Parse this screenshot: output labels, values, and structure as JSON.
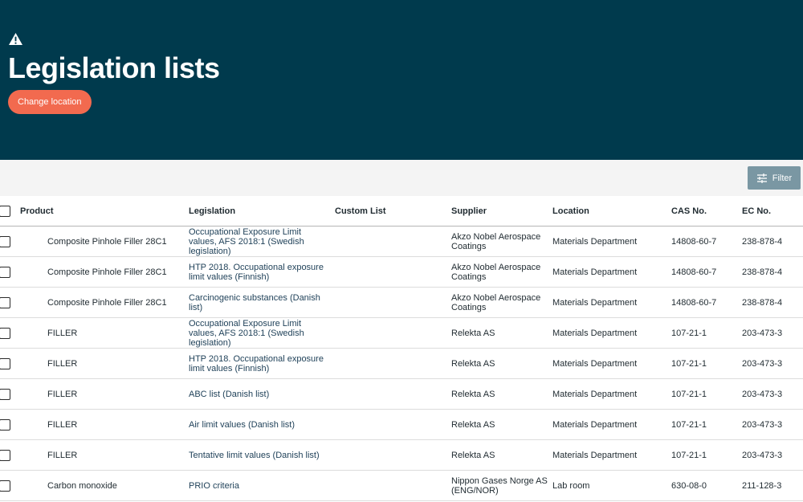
{
  "header": {
    "title": "Legislation lists",
    "change_location_label": "Change location",
    "warning_icon": "warning-triangle-icon"
  },
  "toolbar": {
    "filter_label": "Filter",
    "filter_icon": "sliders-icon"
  },
  "table": {
    "columns": {
      "product": "Product",
      "legislation": "Legislation",
      "custom_list": "Custom List",
      "supplier": "Supplier",
      "location": "Location",
      "cas": "CAS No.",
      "ec": "EC No."
    },
    "rows": [
      {
        "product": "Composite Pinhole Filler 28C1",
        "legislation": "Occupational Exposure Limit values, AFS 2018:1 (Swedish legislation)",
        "custom_list": "",
        "supplier": "Akzo Nobel Aerospace Coatings",
        "location": "Materials Department",
        "cas": "14808-60-7",
        "ec": "238-878-4"
      },
      {
        "product": "Composite Pinhole Filler 28C1",
        "legislation": "HTP 2018. Occupational exposure limit values (Finnish)",
        "custom_list": "",
        "supplier": "Akzo Nobel Aerospace Coatings",
        "location": "Materials Department",
        "cas": "14808-60-7",
        "ec": "238-878-4"
      },
      {
        "product": "Composite Pinhole Filler 28C1",
        "legislation": "Carcinogenic substances (Danish list)",
        "custom_list": "",
        "supplier": "Akzo Nobel Aerospace Coatings",
        "location": "Materials Department",
        "cas": "14808-60-7",
        "ec": "238-878-4"
      },
      {
        "product": "FILLER",
        "legislation": "Occupational Exposure Limit values, AFS 2018:1 (Swedish legislation)",
        "custom_list": "",
        "supplier": "Relekta AS",
        "location": "Materials Department",
        "cas": "107-21-1",
        "ec": "203-473-3"
      },
      {
        "product": "FILLER",
        "legislation": "HTP 2018. Occupational exposure limit values (Finnish)",
        "custom_list": "",
        "supplier": "Relekta AS",
        "location": "Materials Department",
        "cas": "107-21-1",
        "ec": "203-473-3"
      },
      {
        "product": "FILLER",
        "legislation": "ABC list (Danish list)",
        "custom_list": "",
        "supplier": "Relekta AS",
        "location": "Materials Department",
        "cas": "107-21-1",
        "ec": "203-473-3"
      },
      {
        "product": "FILLER",
        "legislation": "Air limit values (Danish list)",
        "custom_list": "",
        "supplier": "Relekta AS",
        "location": "Materials Department",
        "cas": "107-21-1",
        "ec": "203-473-3"
      },
      {
        "product": "FILLER",
        "legislation": "Tentative limit values (Danish list)",
        "custom_list": "",
        "supplier": "Relekta AS",
        "location": "Materials Department",
        "cas": "107-21-1",
        "ec": "203-473-3"
      },
      {
        "product": "Carbon monoxide",
        "legislation": "PRIO criteria",
        "custom_list": "",
        "supplier": "Nippon Gases Norge AS (ENG/NOR)",
        "location": "Lab room",
        "cas": "630-08-0",
        "ec": "211-128-3"
      }
    ]
  },
  "colors": {
    "header_bg": "#003a4d",
    "accent_button": "#f26a4f",
    "filter_button": "#7a97a3",
    "toolbar_bg": "#f4f4f4"
  }
}
